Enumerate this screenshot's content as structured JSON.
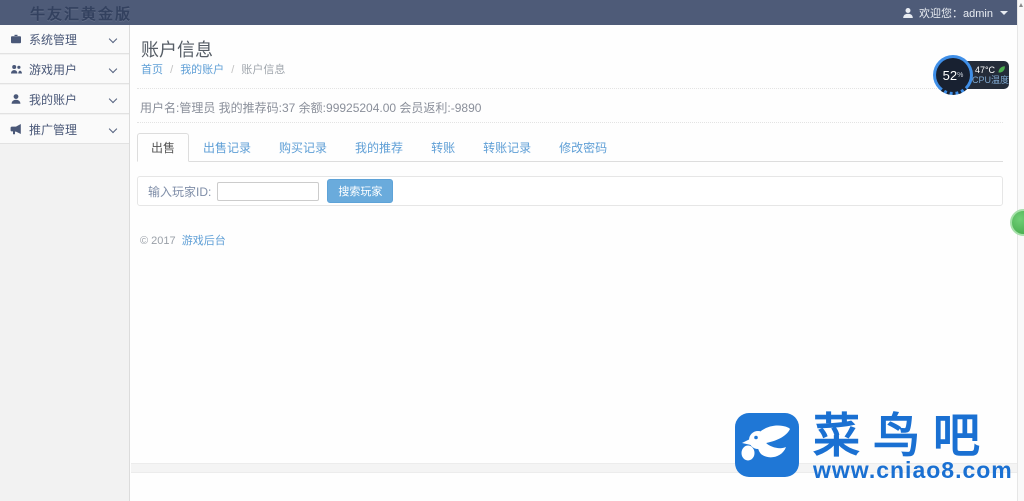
{
  "navbar": {
    "brand": "牛友汇黄金版",
    "welcome": "欢迎您：admin"
  },
  "sidebar": {
    "items": [
      {
        "label": "系统管理",
        "icon": "briefcase-icon"
      },
      {
        "label": "游戏用户",
        "icon": "users-icon"
      },
      {
        "label": "我的账户",
        "icon": "user-icon"
      },
      {
        "label": "推广管理",
        "icon": "bullhorn-icon"
      }
    ]
  },
  "page": {
    "title": "账户信息",
    "breadcrumb": [
      "首页",
      "我的账户",
      "账户信息"
    ],
    "user_info": "用户名:管理员 我的推荐码:37 余额:99925204.00 会员返利:-9890"
  },
  "gauge": {
    "percent": "52",
    "percent_unit": "%",
    "temp": "47°C",
    "label": "CPU温度"
  },
  "tabs": [
    "出售",
    "出售记录",
    "购买记录",
    "我的推荐",
    "转账",
    "转账记录",
    "修改密码"
  ],
  "form": {
    "label": "输入玩家ID:",
    "input_value": "",
    "button": "搜索玩家"
  },
  "footer": {
    "copyright": "© 2017",
    "link": "游戏后台"
  },
  "watermark": {
    "title": "菜鸟吧",
    "url": "www.cniao8.com"
  },
  "colors": {
    "navbar": "#4e5b78",
    "link_blue": "#5f9fd6",
    "button_blue": "#6aabdc",
    "gauge_ring": "#3f8fe8",
    "badge_green": "#4caf50",
    "watermark_blue": "#1a70d2"
  }
}
